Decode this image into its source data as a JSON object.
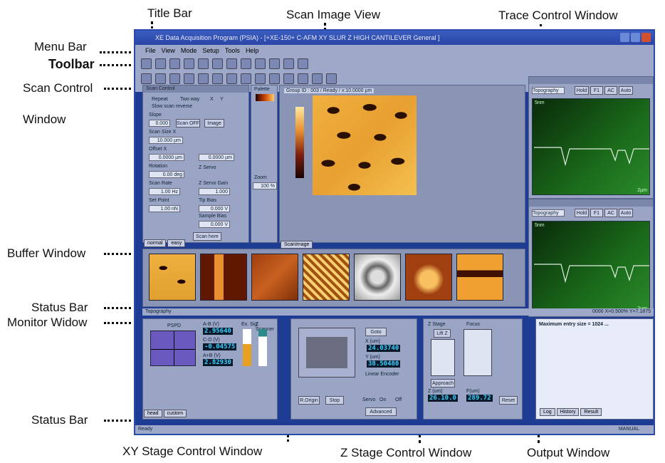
{
  "annotations": {
    "title_bar": "Title Bar",
    "scan_image_view": "Scan Image View",
    "trace_control_window": "Trace Control Window",
    "menu_bar": "Menu Bar",
    "toolbar": "Toolbar",
    "scan_control": "Scan Control",
    "window": "Window",
    "buffer_window": "Buffer Window",
    "status_bar_1": "Status Bar",
    "monitor_widow": "Monitor Widow",
    "status_bar_2": "Status Bar",
    "xy_stage": "XY Stage Control Window",
    "z_stage": "Z Stage Control Window",
    "output_window": "Output Window"
  },
  "app": {
    "title": "XE Data Acquisition Program (PSIA) - [+XE-150+ C-AFM XY SLUR Z HIGH CANTILEVER General ]",
    "menu": [
      "File",
      "View",
      "Mode",
      "Setup",
      "Tools",
      "Help"
    ]
  },
  "scan_control": {
    "header": "Scan Control",
    "repeat": "Repeat",
    "two_way": "Two way",
    "x": "X",
    "y": "Y",
    "slow_scan": "Slow scan reverse",
    "slope": "Slope",
    "slope_val": "0.000",
    "scan_off": "Scan OFF",
    "image": "Image",
    "scan_size": "Scan Size X",
    "scan_size_val": "10.000 µm",
    "offset": "Offset X",
    "offset_x": "0.0000 µm",
    "offset_y": "0.0000 µm",
    "rotation": "Rotation",
    "rotation_val": "0.00 deg",
    "z_servo": "Z Servo",
    "scan_rate": "Scan Rate",
    "scan_rate_val": "1.00 Hz",
    "z_servo_gain": "Z Servo Gain",
    "z_servo_gain_val": "1.000",
    "set_point": "Set Point",
    "set_point_val": "1.00 nN",
    "tip_bias": "Tip Bias",
    "tip_bias_val": "0.000 V",
    "sample_bias": "Sample Bias",
    "sample_bias_val": "0.000 V",
    "scan_here": "Scan here",
    "tabs": [
      "normal",
      "easy"
    ]
  },
  "image_view": {
    "palette": "Palette",
    "status": "Group ID : 003 / Ready / x:10.0000 µm",
    "zoom": "Zoom",
    "zoom_val": "100 %",
    "tab": "ScanImage"
  },
  "trace": {
    "mode": "Topography",
    "buttons": [
      "Hold",
      "F1",
      "AC",
      "Auto"
    ],
    "label_top": "5nm",
    "label_bottom": "2µm"
  },
  "status_bar": {
    "left": "Topography",
    "right": "0000   X=0.500%   Y=7.1875"
  },
  "monitor": {
    "pspd": "PSPD",
    "ab": "A-B (V)",
    "ab_val": "2.95640",
    "cd": "C-D (V)",
    "cd_val": "-0.04575",
    "apb": "A+B (V)",
    "apb_val": "2.82930",
    "ex_sig": "Ex. Sig.",
    "z_scanner": "Z Scanner",
    "tabs": [
      "head",
      "custom"
    ]
  },
  "xy_stage": {
    "goto": "Goto",
    "x_um": "X (um)",
    "x_val": "24.03740",
    "y_um": "Y (um)",
    "y_val": "38.50480",
    "linear": "Linear Encoder",
    "origin": "R.Origin",
    "stop": "Stop",
    "servo": "Servo",
    "on": "On",
    "off": "Off",
    "advanced": "Advanced"
  },
  "z_stage": {
    "header": "Z Stage",
    "lift": "Lift Z",
    "approach": "Approach",
    "z_um": "Z (um)",
    "z_val": "26.10.0",
    "focus": "Focus",
    "f_um": "F(um)",
    "f_val": "289.72",
    "reset": "Reset"
  },
  "output": {
    "message": "Maximum entry size = 1024 ...",
    "tabs": [
      "Log",
      "History",
      "Result"
    ]
  },
  "bottom_status": {
    "left": "Ready",
    "right": "MANUAL"
  }
}
